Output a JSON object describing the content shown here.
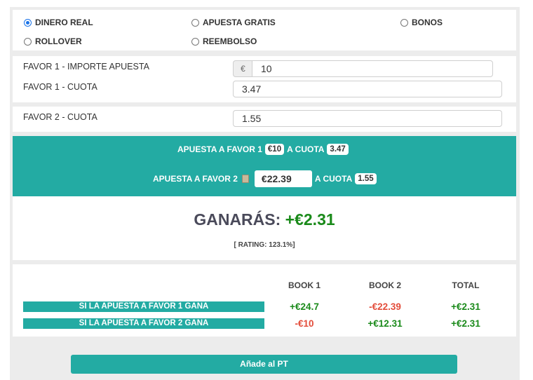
{
  "options": {
    "dinero_real": "DINERO REAL",
    "apuesta_gratis": "APUESTA GRATIS",
    "bonos": "BONOS",
    "rollover": "ROLLOVER",
    "reembolso": "REEMBOLSO",
    "selected": "DINERO REAL"
  },
  "favor1": {
    "importe_label": "FAVOR 1 - IMPORTE APUESTA",
    "currency_prefix": "€",
    "importe_value": "10",
    "cuota_label": "FAVOR 1 - CUOTA",
    "cuota_value": "3.47"
  },
  "favor2": {
    "cuota_label": "FAVOR 2 - CUOTA",
    "cuota_value": "1.55"
  },
  "summary": {
    "line1_prefix": "APUESTA A FAVOR 1",
    "line1_amount": "€10",
    "line1_mid": "A CUOTA",
    "line1_cuota": "3.47",
    "line2_prefix": "APUESTA A FAVOR 2",
    "line2_amount": "€22.39",
    "line2_mid": "A CUOTA",
    "line2_cuota": "1.55"
  },
  "result": {
    "label": "GANARÁS:",
    "amount": "+€2.31",
    "rating": "[ RATING: 123.1%]"
  },
  "table": {
    "headers": [
      "BOOK 1",
      "BOOK 2",
      "TOTAL"
    ],
    "rows": [
      {
        "label": "SI LA APUESTA A FAVOR 1 GANA",
        "book1": "+€24.7",
        "book2": "-€22.39",
        "total": "+€2.31"
      },
      {
        "label": "SI LA APUESTA A FAVOR 2 GANA",
        "book1": "-€10",
        "book2": "+€12.31",
        "total": "+€2.31"
      }
    ]
  },
  "add_button": "Añade al PT",
  "colors": {
    "accent": "#23aba3",
    "positive": "#1a8a1a",
    "negative": "#e34c3a",
    "radio_selected": "#1a73e8"
  }
}
